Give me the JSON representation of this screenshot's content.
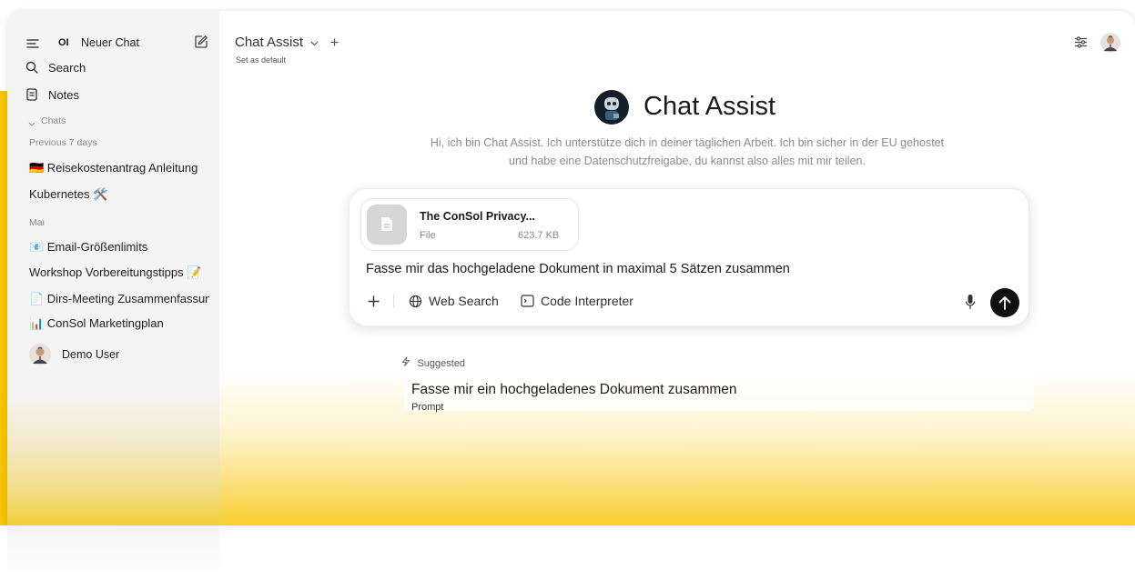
{
  "sidebar": {
    "new_chat_logo": "OI",
    "new_chat": "Neuer Chat",
    "search": "Search",
    "notes": "Notes",
    "chats_section": "Chats",
    "groups": [
      {
        "label": "Previous 7 days",
        "items": [
          "🇩🇪 Reisekostenantrag Anleitung",
          "Kubernetes 🛠️"
        ]
      },
      {
        "label": "Mai",
        "items": [
          "📧 Email-Größenlimits",
          "Workshop Vorbereitungstipps 📝",
          "📄 Dirs-Meeting Zusammenfassung",
          "📊 ConSol Marketingplan"
        ]
      }
    ],
    "user_name": "Demo User"
  },
  "header": {
    "model_name": "Chat Assist",
    "set_default": "Set as default"
  },
  "hero": {
    "title": "Chat Assist",
    "description": "Hi, ich bin Chat Assist. Ich unterstütze dich in deiner täglichen Arbeit. Ich bin sicher in der EU gehostet und habe eine Datenschutzfreigabe, du kannst also alles mit mir teilen."
  },
  "composer": {
    "file": {
      "name": "The ConSol Privacy...",
      "type": "File",
      "size": "623.7 KB"
    },
    "input_text": "Fasse mir das hochgeladene Dokument in maximal 5 Sätzen zusammen",
    "tools": {
      "web_search": "Web Search",
      "code_interpreter": "Code Interpreter"
    }
  },
  "suggested": {
    "label": "Suggested",
    "items": [
      {
        "title": "Fasse mir ein hochgeladenes Dokument zusammen",
        "subtitle": "Prompt"
      }
    ]
  },
  "colors": {
    "accent_yellow": "#f8cf2e",
    "send_button": "#111111"
  }
}
